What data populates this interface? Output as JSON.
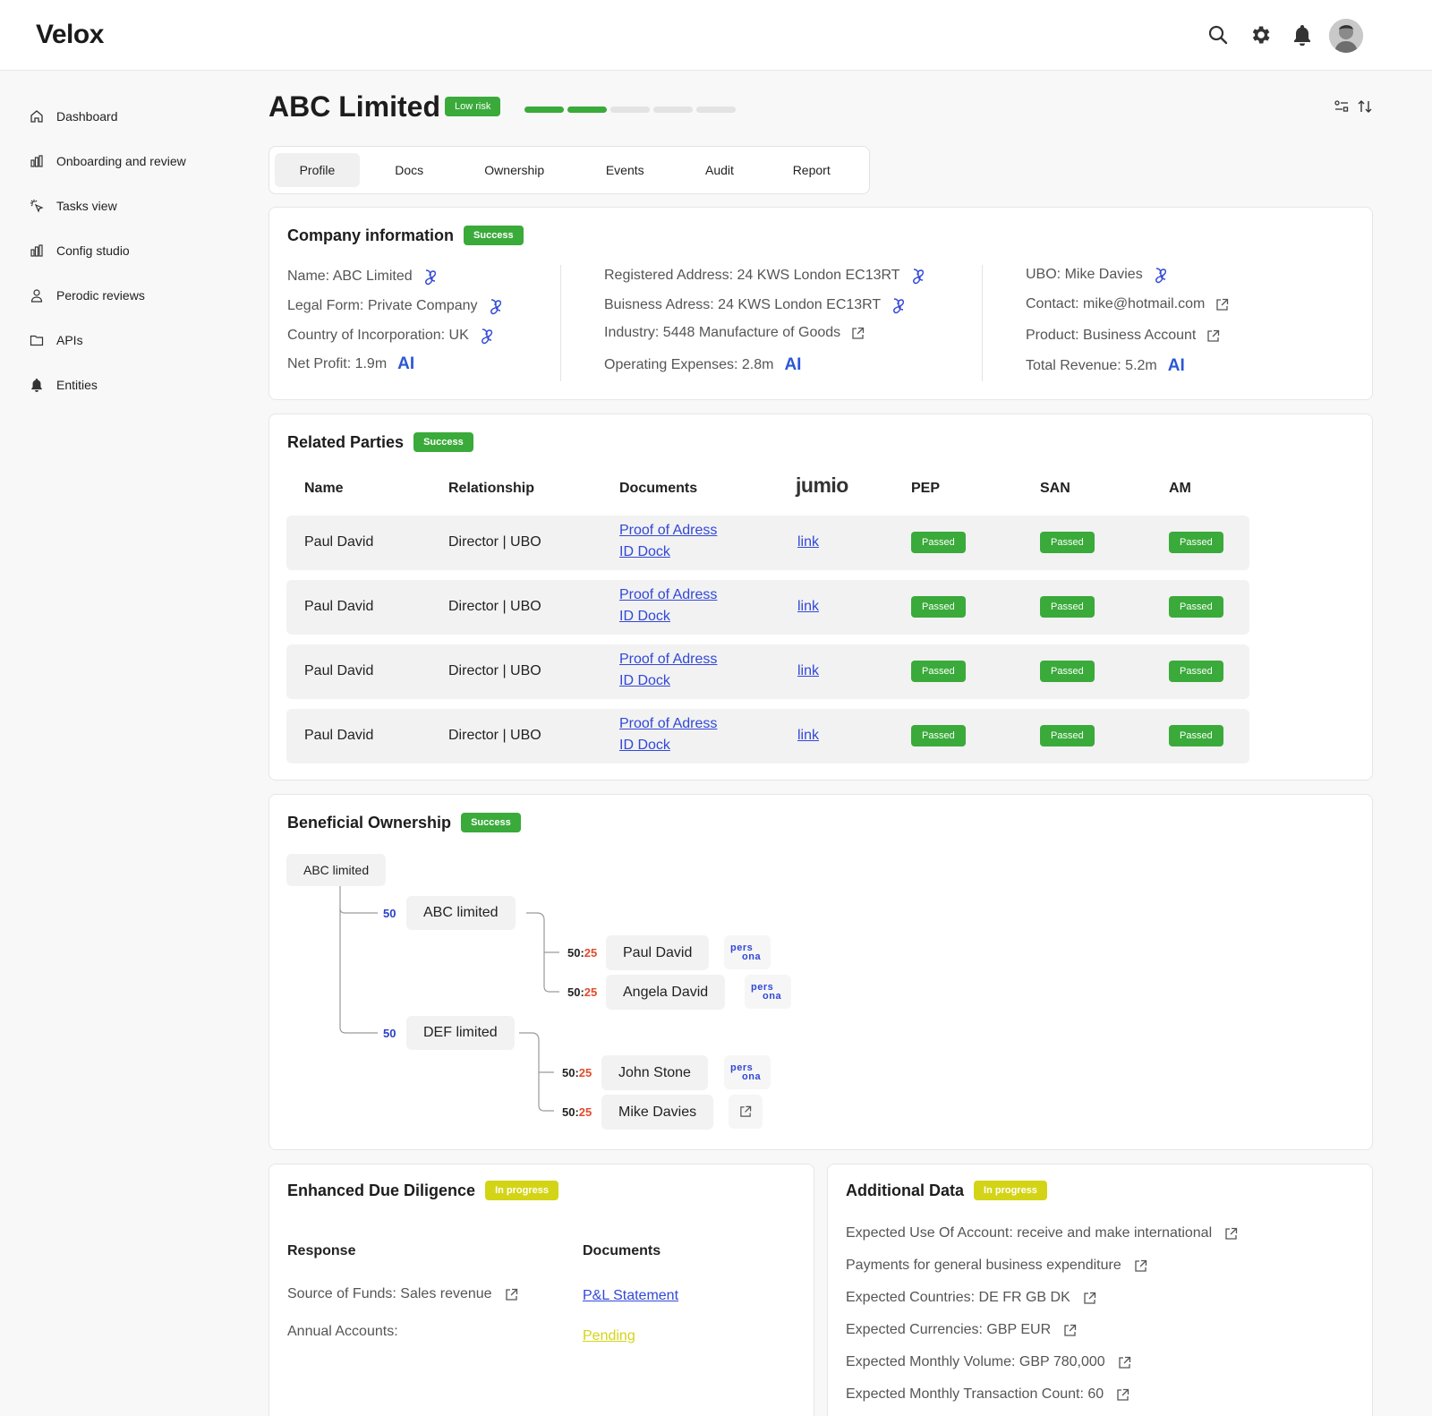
{
  "app": {
    "logo": "Velox"
  },
  "topbar_icons": [
    "search-icon",
    "gear-icon",
    "bell-icon"
  ],
  "sidebar": {
    "items": [
      {
        "label": "Dashboard",
        "icon": "home-icon"
      },
      {
        "label": "Onboarding and review",
        "icon": "chart-icon"
      },
      {
        "label": "Tasks view",
        "icon": "sparkle-click-icon"
      },
      {
        "label": "Config studio",
        "icon": "chart-icon"
      },
      {
        "label": "Perodic reviews",
        "icon": "user-icon"
      },
      {
        "label": "APIs",
        "icon": "folder-icon"
      },
      {
        "label": "Entities",
        "icon": "bell-icon"
      }
    ]
  },
  "header": {
    "title": "ABC Limited",
    "risk_badge": "Low risk",
    "risk_level_segments_filled": 2,
    "risk_level_segments_total": 5,
    "colors": {
      "risk_filled": "#3aaa3a",
      "risk_empty": "#e3e3e3"
    }
  },
  "tabs": [
    "Profile",
    "Docs",
    "Ownership",
    "Events",
    "Audit",
    "Report"
  ],
  "active_tab": "Profile",
  "company_info": {
    "title": "Company information",
    "status": "Success",
    "col1": [
      {
        "text": "Name: ABC Limited",
        "icon": "link-chain-icon"
      },
      {
        "text": "Legal Form: Private Company",
        "icon": "link-chain-icon"
      },
      {
        "text": "Country of Incorporation: UK",
        "icon": "link-chain-icon"
      },
      {
        "text": "Net Profit: 1.9m",
        "icon": "ai-icon",
        "ai": "AI"
      }
    ],
    "col2": [
      {
        "text": "Registered Address: 24 KWS London EC13RT",
        "icon": "link-chain-icon"
      },
      {
        "text": "Buisness Adress: 24 KWS London EC13RT",
        "icon": "link-chain-icon"
      },
      {
        "text": "Industry: 5448 Manufacture of Goods",
        "icon": "external-link-icon"
      },
      {
        "text": "Operating Expenses: 2.8m",
        "icon": "ai-icon",
        "ai": "AI"
      }
    ],
    "col3": [
      {
        "text": "UBO: Mike Davies",
        "icon": "link-chain-icon"
      },
      {
        "text": "Contact: mike@hotmail.com",
        "icon": "external-link-icon"
      },
      {
        "text": "Product: Business Account",
        "icon": "external-link-icon"
      },
      {
        "text": "Total Revenue: 5.2m",
        "icon": "ai-icon",
        "ai": "AI"
      }
    ]
  },
  "related_parties": {
    "title": "Related Parties",
    "status": "Success",
    "columns": [
      "Name",
      "Relationship",
      "Documents",
      "jumio",
      "PEP",
      "SAN",
      "AM"
    ],
    "rows": [
      {
        "name": "Paul David",
        "relationship": "Director | UBO",
        "doc1": "Proof of Adress",
        "doc2": "ID Dock",
        "jumio": "link",
        "pep": "Passed",
        "san": "Passed",
        "am": "Passed"
      },
      {
        "name": "Paul David",
        "relationship": "Director | UBO",
        "doc1": "Proof of Adress",
        "doc2": "ID Dock",
        "jumio": "link",
        "pep": "Passed",
        "san": "Passed",
        "am": "Passed"
      },
      {
        "name": "Paul David",
        "relationship": "Director | UBO",
        "doc1": "Proof of Adress",
        "doc2": "ID Dock",
        "jumio": "link",
        "pep": "Passed",
        "san": "Passed",
        "am": "Passed"
      },
      {
        "name": "Paul David",
        "relationship": "Director | UBO",
        "doc1": "Proof of Adress",
        "doc2": "ID Dock",
        "jumio": "link",
        "pep": "Passed",
        "san": "Passed",
        "am": "Passed"
      }
    ]
  },
  "beneficial_ownership": {
    "title": "Beneficial Ownership",
    "status": "Success",
    "root": "ABC limited",
    "branches": [
      {
        "pct": "50",
        "name": "ABC limited",
        "children": [
          {
            "ratio_a": "50:",
            "ratio_b": "25",
            "name": "Paul David",
            "tag_top": "pers",
            "tag_bottom": "ona"
          },
          {
            "ratio_a": "50:",
            "ratio_b": "25",
            "name": "Angela David",
            "tag_top": "pers",
            "tag_bottom": "ona"
          }
        ]
      },
      {
        "pct": "50",
        "name": "DEF limited",
        "children": [
          {
            "ratio_a": "50:",
            "ratio_b": "25",
            "name": "John Stone",
            "tag_top": "pers",
            "tag_bottom": "ona"
          },
          {
            "ratio_a": "50:",
            "ratio_b": "25",
            "name": "Mike Davies",
            "tag_top": "",
            "tag_bottom": ""
          }
        ]
      }
    ]
  },
  "edd": {
    "title": "Enhanced Due Diligence",
    "status": "In progress",
    "response_header": "Response",
    "documents_header": "Documents",
    "rows": [
      {
        "response": "Source of Funds: Sales revenue",
        "document": "P&L Statement"
      },
      {
        "response": "Annual Accounts:",
        "document": "Pending"
      }
    ]
  },
  "additional_data": {
    "title": "Additional Data",
    "status": "In progress",
    "rows": [
      "Expected Use Of Account: receive and make international",
      "Payments for general business expenditure",
      "Expected Countries: DE FR GB DK",
      "Expected Currencies: GBP EUR",
      "Expected Monthly Volume: GBP 780,000",
      "Expected Monthly Transaction Count: 60"
    ]
  }
}
